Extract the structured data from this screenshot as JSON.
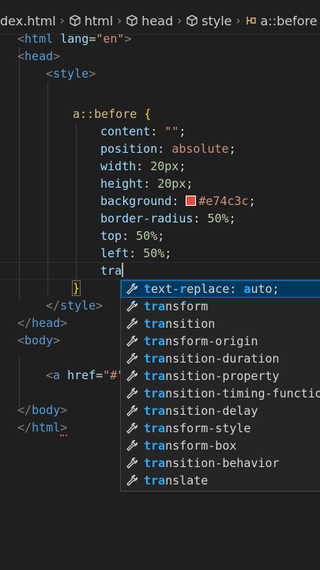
{
  "breadcrumb": {
    "items": [
      {
        "label": "dex.html",
        "icon": "none"
      },
      {
        "label": "html",
        "icon": "cube-icon"
      },
      {
        "label": "head",
        "icon": "cube-icon"
      },
      {
        "label": "style",
        "icon": "cube-icon"
      },
      {
        "label": "a::before",
        "icon": "css-selector-icon"
      }
    ]
  },
  "code": {
    "l1": {
      "open": "<",
      "tag": "html",
      "attr": "lang",
      "eq": "=",
      "val": "\"en\"",
      "close": ">"
    },
    "l2": {
      "open": "<",
      "tag": "head",
      "close": ">"
    },
    "l3": {
      "open": "<",
      "tag": "style",
      "close": ">"
    },
    "l4": {
      "selector": "a::before",
      "brace": "{"
    },
    "content": {
      "prop": "content",
      "colon": ":",
      "val": "\"\"",
      "semi": ";"
    },
    "position": {
      "prop": "position",
      "colon": ":",
      "val": "absolute",
      "semi": ";"
    },
    "width": {
      "prop": "width",
      "colon": ":",
      "val": "20px",
      "semi": ";"
    },
    "height": {
      "prop": "height",
      "colon": ":",
      "val": "20px",
      "semi": ";"
    },
    "background": {
      "prop": "background",
      "colon": ":",
      "val": "#e74c3c",
      "semi": ";"
    },
    "radius": {
      "prop": "border-radius",
      "colon": ":",
      "val": "50%",
      "semi": ";"
    },
    "top": {
      "prop": "top",
      "colon": ":",
      "val": "50%",
      "semi": ";"
    },
    "left": {
      "prop": "left",
      "colon": ":",
      "val": "50%",
      "semi": ";"
    },
    "typed": "tra",
    "close_brace": "}",
    "style_close": {
      "open": "</",
      "tag": "style",
      "close": ">"
    },
    "head_close": {
      "open": "</",
      "tag": "head",
      "close": ">"
    },
    "body_open": {
      "open": "<",
      "tag": "body",
      "close": ">"
    },
    "anchor": {
      "open": "<",
      "tag": "a",
      "attr": "href",
      "eq": "=",
      "val": "\"#\""
    },
    "body_close": {
      "open": "</",
      "tag": "body",
      "close": ">"
    },
    "html_close": {
      "open": "</",
      "tag": "html",
      "close": ">"
    }
  },
  "swatch_color": "#e74c3c",
  "suggestions": {
    "typed_prefix": "tra",
    "items": [
      {
        "match": "t",
        "m2": "",
        "rest_a": "ext-",
        "m3": "r",
        "rest_b": "eplace: ",
        "m4": "a",
        "rest_c": "uto;",
        "active": true
      },
      {
        "match": "tra",
        "rest": "nsform"
      },
      {
        "match": "tra",
        "rest": "nsition"
      },
      {
        "match": "tra",
        "rest": "nsform-origin"
      },
      {
        "match": "tra",
        "rest": "nsition-duration"
      },
      {
        "match": "tra",
        "rest": "nsition-property"
      },
      {
        "match": "tra",
        "rest": "nsition-timing-function"
      },
      {
        "match": "tra",
        "rest": "nsition-delay"
      },
      {
        "match": "tra",
        "rest": "nsform-style"
      },
      {
        "match": "tra",
        "rest": "nsform-box"
      },
      {
        "match": "tra",
        "rest": "nsition-behavior"
      },
      {
        "match": "tra",
        "rest": "nslate"
      }
    ]
  }
}
